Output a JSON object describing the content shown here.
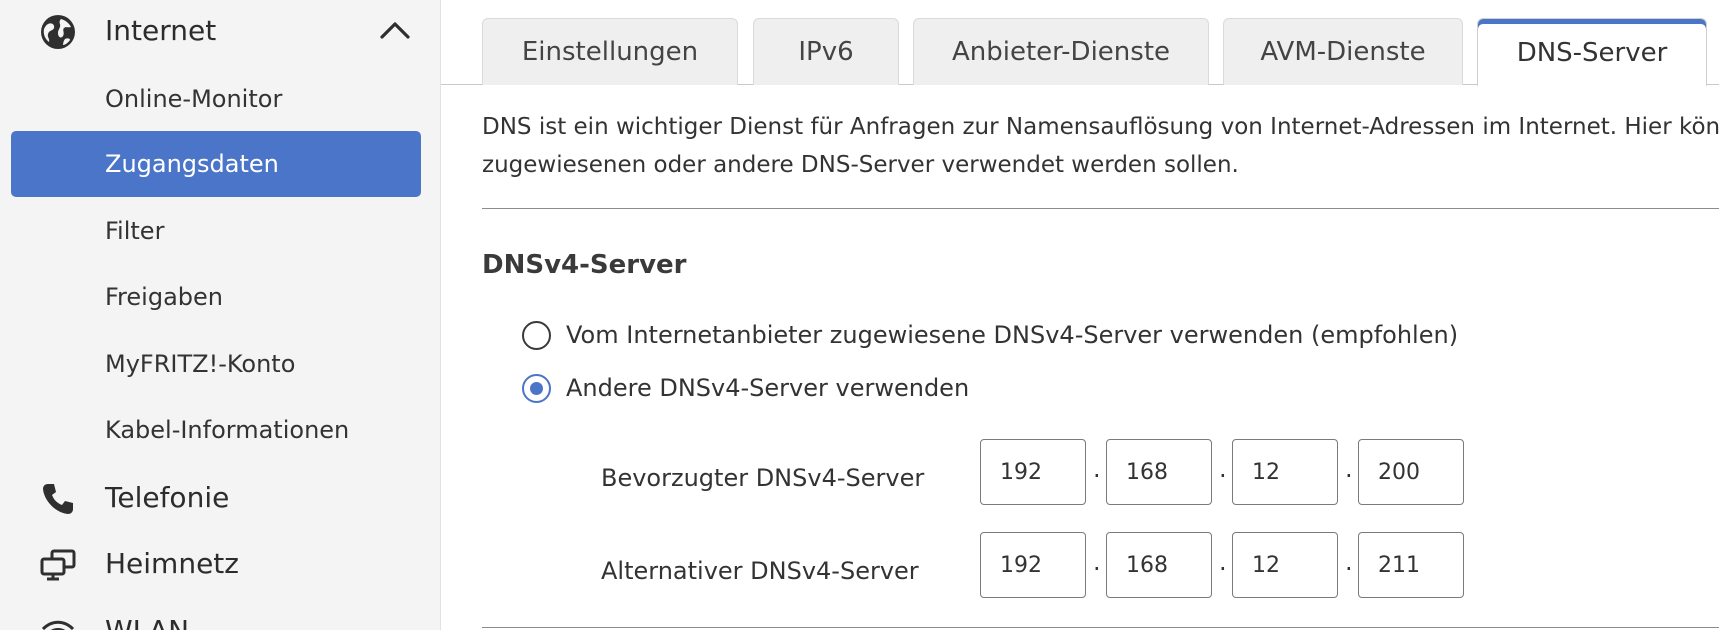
{
  "sidebar": {
    "sections": {
      "internet": {
        "label": "Internet",
        "icon": "globe-icon",
        "expanded": true
      },
      "telefonie": {
        "label": "Telefonie",
        "icon": "phone-icon"
      },
      "heimnetz": {
        "label": "Heimnetz",
        "icon": "monitor-network-icon"
      },
      "wlan": {
        "label": "WLAN",
        "icon": "wifi-icon"
      }
    },
    "internet_items": [
      {
        "label": "Online-Monitor"
      },
      {
        "label": "Zugangsdaten",
        "active": true
      },
      {
        "label": "Filter"
      },
      {
        "label": "Freigaben"
      },
      {
        "label": "MyFRITZ!-Konto"
      },
      {
        "label": "Kabel-Informationen"
      }
    ]
  },
  "tabs": [
    {
      "label": "Einstellungen"
    },
    {
      "label": "IPv6"
    },
    {
      "label": "Anbieter-Dienste"
    },
    {
      "label": "AVM-Dienste"
    },
    {
      "label": "DNS-Server",
      "active": true
    }
  ],
  "content": {
    "description_line1": "DNS ist ein wichtiger Dienst für Anfragen zur Namensauflösung von Internet-Adressen im Internet. Hier könne",
    "description_line2": "zugewiesenen oder andere DNS-Server verwendet werden sollen.",
    "section_title": "DNSv4-Server",
    "radio_provider": {
      "label": "Vom Internetanbieter zugewiesene DNSv4-Server verwenden (empfohlen)",
      "checked": false
    },
    "radio_other": {
      "label": "Andere DNSv4-Server verwenden",
      "checked": true
    },
    "preferred": {
      "label": "Bevorzugter DNSv4-Server",
      "octets": [
        "192",
        "168",
        "12",
        "200"
      ]
    },
    "alternative": {
      "label": "Alternativer DNSv4-Server",
      "octets": [
        "192",
        "168",
        "12",
        "211"
      ]
    },
    "ip_separator": "."
  },
  "colors": {
    "accent": "#4b75c9",
    "sidebar_bg": "#f4f4f4",
    "tab_bg": "#efefef"
  }
}
